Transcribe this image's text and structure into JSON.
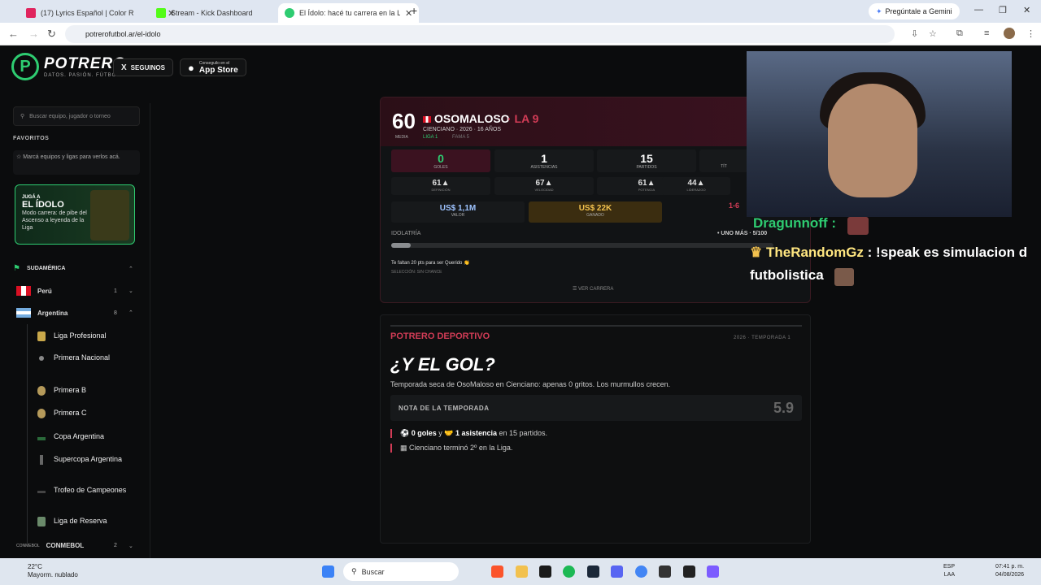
{
  "browser": {
    "tabs": [
      {
        "title": "(17) Lyrics Español | Color R",
        "color": "#e0245e"
      },
      {
        "title": "Stream - Kick Dashboard",
        "color": "#53fc18"
      },
      {
        "title": "El Ídolo: hacé tu carrera en la Li",
        "color": "#2ecc71"
      }
    ],
    "new_tab": "+",
    "gemini": "Pregúntale a Gemini",
    "url": "potrerofutbol.ar/el-idolo"
  },
  "header": {
    "logo_letter": "P",
    "logo_name": "POTRERO",
    "logo_tag": "DATOS. PASIÓN. FÚTBOL.",
    "follow": "SEGUINOS",
    "follow_icon": "X",
    "store_small": "Conseguilo en el",
    "store_big": "App Store"
  },
  "sidebar": {
    "search_placeholder": "Buscar equipo, jugador o torneo",
    "favorites_title": "FAVORITOS",
    "favorites_hint": "Marcá equipos y ligas para verlos acá.",
    "promo": {
      "pre": "JUGÁ A",
      "title": "EL ÍDOLO",
      "text": "Modo carrera: de pibe del Ascenso a leyenda de la Liga"
    },
    "region": "SUDAMÉRICA",
    "countries": [
      {
        "name": "Perú",
        "count": "1"
      },
      {
        "name": "Argentina",
        "count": "8"
      }
    ],
    "leagues": [
      "Liga Profesional",
      "Primera Nacional",
      "Primera B",
      "Primera C",
      "Copa Argentina",
      "Supercopa Argentina",
      "Trofeo de Campeones",
      "Liga de Reserva"
    ],
    "conmebol": {
      "name": "CONMEBOL",
      "count": "2"
    }
  },
  "card": {
    "rating": "60",
    "rating_label": "MEDIA",
    "name": "OSOMALOSO",
    "position": "· LA 9",
    "info": "CIENCIANO · 2026 · 16 AÑOS",
    "league": "LIGA 1",
    "fame": "FAMA 5",
    "stats": [
      {
        "value": "0",
        "label": "GOLES"
      },
      {
        "value": "1",
        "label": "ASISTENCIAS"
      },
      {
        "value": "15",
        "label": "PARTIDOS"
      },
      {
        "value": "",
        "label": "TÍT"
      }
    ],
    "attrs": [
      {
        "value": "61▲",
        "label": "DEFINICIÓN"
      },
      {
        "value": "67▲",
        "label": "VELOCIDAD"
      },
      {
        "value": "61▲",
        "label": "POTENCIA"
      },
      {
        "value": "44▲",
        "label": "LIDERAZGO"
      }
    ],
    "money": [
      {
        "value": "US$ 1,1M",
        "label": "VALOR"
      },
      {
        "value": "US$ 22K",
        "label": "GANADO"
      }
    ],
    "last_result": "1-6",
    "idol_label": "IDOLATRÍA",
    "idol_right": "• UNO MÁS · 5/100",
    "idol_progress": 0.05,
    "idol_note": "Te faltan 20 pts para ser Querido 👏",
    "idol_selection": "SELECCIÓN: SIN CHANCE",
    "view_career": "☰  VER CARRERA"
  },
  "season": {
    "brand": "POTRERO DEPORTIVO",
    "year": "2026 · TEMPORADA 1",
    "title": "¿Y EL GOL?",
    "description": "Temporada seca de OsoMaloso en Cienciano: apenas 0 gritos. Los murmullos crecen.",
    "nota_label": "NOTA DE LA TEMPORADA",
    "nota_value": "5.9",
    "fact1_goals": "0 goles",
    "fact1_mid": " y ",
    "fact1_assists": "1 asistencia",
    "fact1_end": " en 15 partidos.",
    "fact2": "Cienciano terminó 2º en la Liga."
  },
  "stream_chat": {
    "msg1_user": "Dragunnoff :",
    "msg2_user": "TheRandomGz",
    "msg2_text": " : !speak es simulacion d",
    "msg2_cont": "futbolistica"
  },
  "taskbar": {
    "temp": "22°C",
    "weather": "Mayorm. nublado",
    "search": "Buscar",
    "lang1": "ESP",
    "lang2": "LAA",
    "time": "07:41 p. m.",
    "date": "04/08/2026"
  }
}
